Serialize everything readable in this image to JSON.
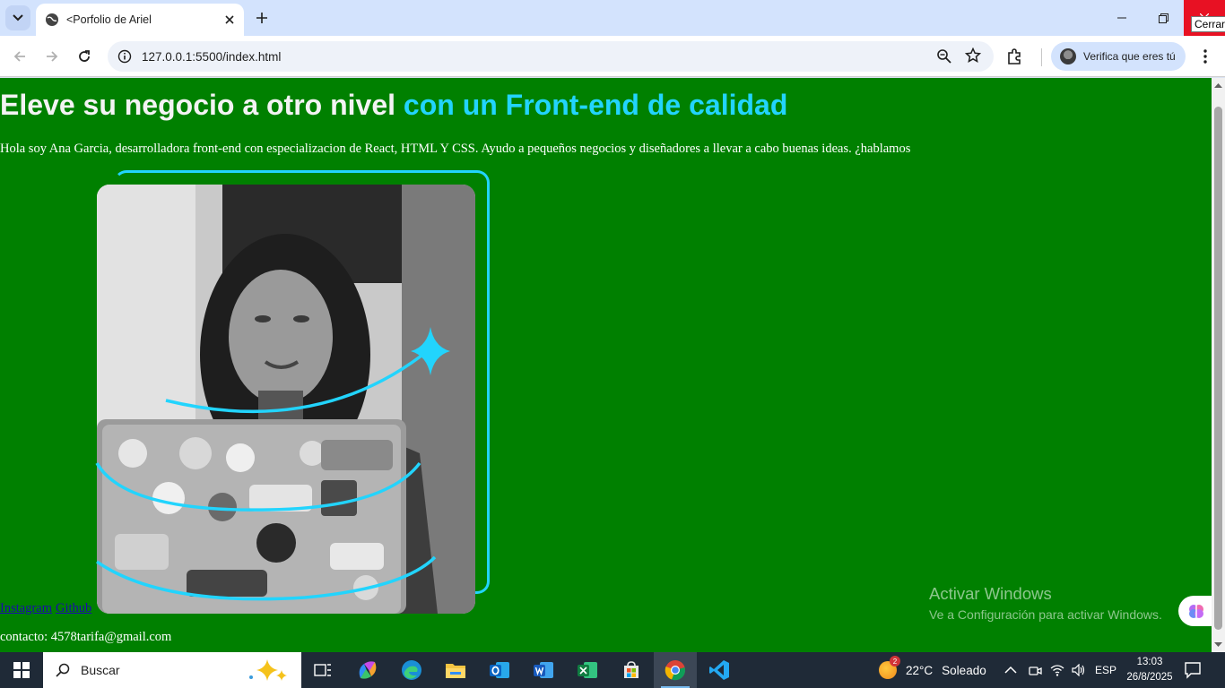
{
  "browser": {
    "tab_title": "<Porfolio de Ariel",
    "url": "127.0.0.1:5500/index.html",
    "profile_label": "Verifica que eres tú",
    "close_tooltip": "Cerrar"
  },
  "page": {
    "headline_main": "Eleve su negocio a otro nivel ",
    "headline_accent": "con un Front-end de calidad",
    "intro": "Hola soy Ana Garcia, desarrolladora front-end con especializacion de React, HTML Y CSS. Ayudo a pequeños negocios y diseñadores a llevar a cabo buenas ideas. ¿hablamos",
    "links": [
      "Instagram",
      "Github"
    ],
    "contact": "contacto: 4578tarifa@gmail.com"
  },
  "watermark": {
    "title": "Activar Windows",
    "subtitle": "Ve a Configuración para activar Windows."
  },
  "taskbar": {
    "search_placeholder": "Buscar",
    "weather_badge": "2",
    "temperature": "22°C",
    "weather_text": "Soleado",
    "language": "ESP",
    "time": "13:03",
    "date": "26/8/2025"
  },
  "colors": {
    "page_bg": "#008000",
    "accent": "#22d4fd",
    "close_red": "#e81123"
  }
}
